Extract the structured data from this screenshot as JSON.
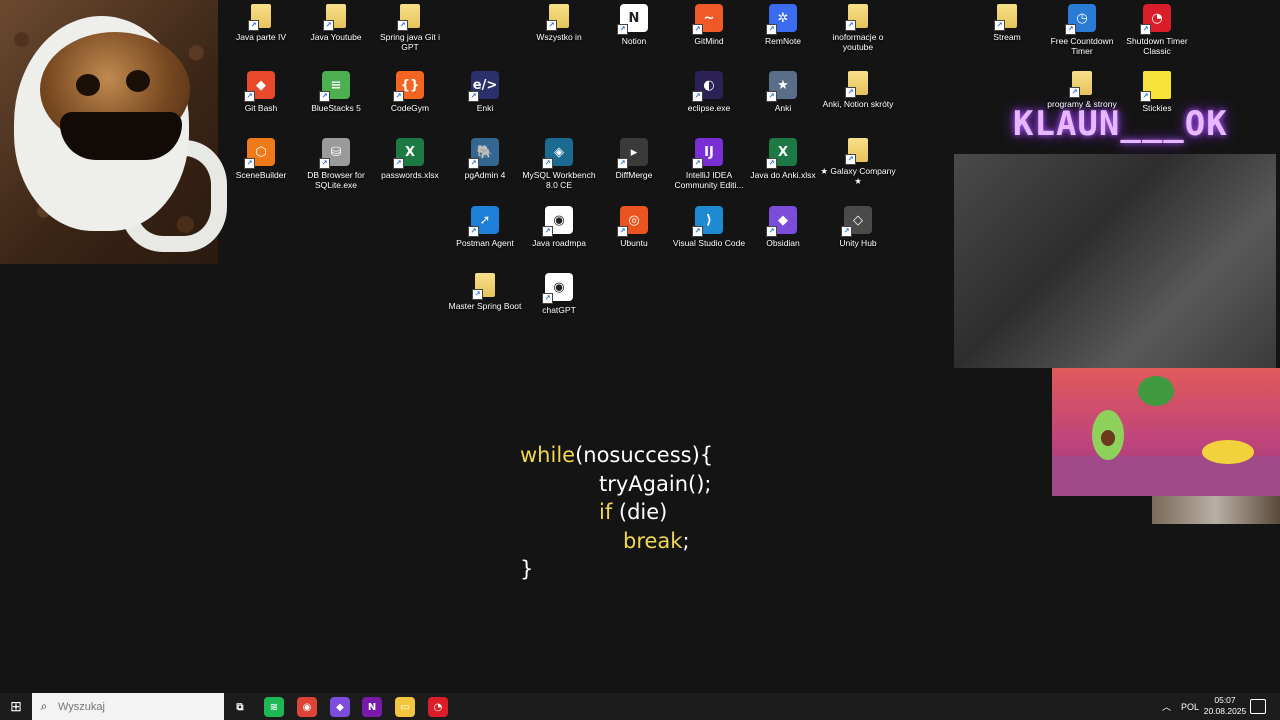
{
  "desktop": {
    "overlay_text": "KLAUN___OK",
    "code_lines": [
      {
        "kw": "while",
        "rest": "(nosuccess){"
      },
      {
        "kw": "",
        "rest": "tryAgain();"
      },
      {
        "kw": "if",
        "rest": " (die)"
      },
      {
        "kw": "break",
        "rest": ";"
      },
      {
        "kw": "",
        "rest": "}"
      }
    ],
    "icons": [
      {
        "id": "java-parte-iv",
        "label": "Java parte IV",
        "icon": "folder-icon",
        "color": "#f3d36b"
      },
      {
        "id": "java-youtube",
        "label": "Java Youtube",
        "icon": "folder-icon",
        "color": "#f3d36b"
      },
      {
        "id": "spring-java-git-gpt",
        "label": "Spring java Git i GPT",
        "icon": "folder-icon",
        "color": "#f3d36b"
      },
      {
        "id": "wszystko-in",
        "label": "Wszystko in",
        "icon": "folder-icon",
        "color": "#f3d36b"
      },
      {
        "id": "notion",
        "label": "Notion",
        "icon": "notion-icon",
        "color": "#ffffff",
        "glyph": "N"
      },
      {
        "id": "gitmind",
        "label": "GitMind",
        "icon": "gitmind-icon",
        "color": "#f05a28",
        "glyph": "~"
      },
      {
        "id": "remnote",
        "label": "RemNote",
        "icon": "remnote-icon",
        "color": "#3a6bf0",
        "glyph": "✲"
      },
      {
        "id": "inoformacje-youtube",
        "label": "inoformacje o youtube",
        "icon": "folder-icon",
        "color": "#f3d36b"
      },
      {
        "id": "stream",
        "label": "Stream",
        "icon": "folder-icon",
        "color": "#f3d36b"
      },
      {
        "id": "free-countdown-timer",
        "label": "Free Countdown Timer",
        "icon": "stopwatch-icon",
        "color": "#2a7bd6",
        "glyph": "◷"
      },
      {
        "id": "shutdown-timer-classic",
        "label": "Shutdown Timer Classic",
        "icon": "shutdown-timer-icon",
        "color": "#d91e2a",
        "glyph": "◔"
      },
      {
        "id": "git-bash",
        "label": "Git Bash",
        "icon": "git-bash-icon",
        "color": "#e8492b",
        "glyph": "◆"
      },
      {
        "id": "bluestacks-5",
        "label": "BlueStacks 5",
        "icon": "bluestacks-icon",
        "color": "#4caf50",
        "glyph": "≡"
      },
      {
        "id": "codegym",
        "label": "CodeGym",
        "icon": "codegym-icon",
        "color": "#f26522",
        "glyph": "{}"
      },
      {
        "id": "enki",
        "label": "Enki",
        "icon": "enki-icon",
        "color": "#2b2f6b",
        "glyph": "e/>"
      },
      {
        "id": "eclipse-exe",
        "label": "eclipse.exe",
        "icon": "eclipse-icon",
        "color": "#2c2255",
        "glyph": "◐"
      },
      {
        "id": "anki",
        "label": "Anki",
        "icon": "anki-icon",
        "color": "#5a6e8a",
        "glyph": "★"
      },
      {
        "id": "anki-notion-skroty",
        "label": "Anki, Notion skróty",
        "icon": "folder-icon",
        "color": "#f3d36b"
      },
      {
        "id": "programy-strony",
        "label": "programy & strony",
        "icon": "folder-icon",
        "color": "#f3d36b"
      },
      {
        "id": "stickies",
        "label": "Stickies",
        "icon": "sticky-note-icon",
        "color": "#f7e23a"
      },
      {
        "id": "scenebuilder",
        "label": "SceneBuilder",
        "icon": "scenebuilder-icon",
        "color": "#f07a1a",
        "glyph": "⬡"
      },
      {
        "id": "db-browser-sqlite",
        "label": "DB Browser for SQLite.exe",
        "icon": "database-icon",
        "color": "#9a9a9a",
        "glyph": "⛁"
      },
      {
        "id": "passwords-xlsx",
        "label": "passwords.xlsx",
        "icon": "excel-icon",
        "color": "#1d7a45",
        "glyph": "X"
      },
      {
        "id": "pgadmin-4",
        "label": "pgAdmin 4",
        "icon": "pgadmin-icon",
        "color": "#336791",
        "glyph": "🐘"
      },
      {
        "id": "mysql-workbench",
        "label": "MySQL Workbench 8.0 CE",
        "icon": "mysql-workbench-icon",
        "color": "#1b6a8f",
        "glyph": "◈"
      },
      {
        "id": "diffmerge",
        "label": "DiffMerge",
        "icon": "diffmerge-icon",
        "color": "#3a3a3a",
        "glyph": "▸"
      },
      {
        "id": "intellij-idea",
        "label": "IntelliJ IDEA Community Editi...",
        "icon": "intellij-icon",
        "color": "#7a2fd6",
        "glyph": "IJ"
      },
      {
        "id": "java-do-anki-xlsx",
        "label": "Java do Anki.xlsx",
        "icon": "excel-icon",
        "color": "#1d7a45",
        "glyph": "X"
      },
      {
        "id": "galaxy-company",
        "label": "★ Galaxy Company ★",
        "icon": "folder-icon",
        "color": "#f3d36b"
      },
      {
        "id": "postman-agent",
        "label": "Postman Agent",
        "icon": "postman-icon",
        "color": "#1e7fd8",
        "glyph": "➚"
      },
      {
        "id": "java-roadmpa",
        "label": "Java roadmpa",
        "icon": "chrome-icon",
        "color": "#ffffff",
        "glyph": "◉"
      },
      {
        "id": "ubuntu",
        "label": "Ubuntu",
        "icon": "ubuntu-icon",
        "color": "#e95420",
        "glyph": "◎"
      },
      {
        "id": "visual-studio-code",
        "label": "Visual Studio Code",
        "icon": "vscode-icon",
        "color": "#1f8ad2",
        "glyph": "⟩"
      },
      {
        "id": "obsidian",
        "label": "Obsidian",
        "icon": "obsidian-icon",
        "color": "#7c4ddb",
        "glyph": "◆"
      },
      {
        "id": "unity-hub",
        "label": "Unity Hub",
        "icon": "unity-icon",
        "color": "#4a4a4a",
        "glyph": "◇"
      },
      {
        "id": "master-spring-boot",
        "label": "Master Spring Boot",
        "icon": "folder-icon",
        "color": "#f3d36b"
      },
      {
        "id": "chatgpt",
        "label": "chatGPT",
        "icon": "chrome-icon",
        "color": "#ffffff",
        "glyph": "◉"
      }
    ]
  },
  "taskbar": {
    "search_placeholder": "Wyszukaj",
    "apps": [
      {
        "id": "task-view",
        "icon": "task-view-icon",
        "color": "#1c1c1c",
        "glyph": "⧉"
      },
      {
        "id": "spotify",
        "icon": "spotify-icon",
        "color": "#1db954",
        "glyph": "≋"
      },
      {
        "id": "chrome",
        "icon": "chrome-icon",
        "color": "#db4437",
        "glyph": "◉"
      },
      {
        "id": "obsidian",
        "icon": "obsidian-icon",
        "color": "#7c4ddb",
        "glyph": "◆"
      },
      {
        "id": "onenote",
        "icon": "onenote-icon",
        "color": "#7719aa",
        "glyph": "N"
      },
      {
        "id": "file-explorer",
        "icon": "folder-icon",
        "color": "#f3c63f",
        "glyph": "▭"
      },
      {
        "id": "timer-app",
        "icon": "timer-icon",
        "color": "#d91e2a",
        "glyph": "◔"
      }
    ],
    "language": "POL",
    "time": "05:07",
    "date": "20.08.2025"
  }
}
